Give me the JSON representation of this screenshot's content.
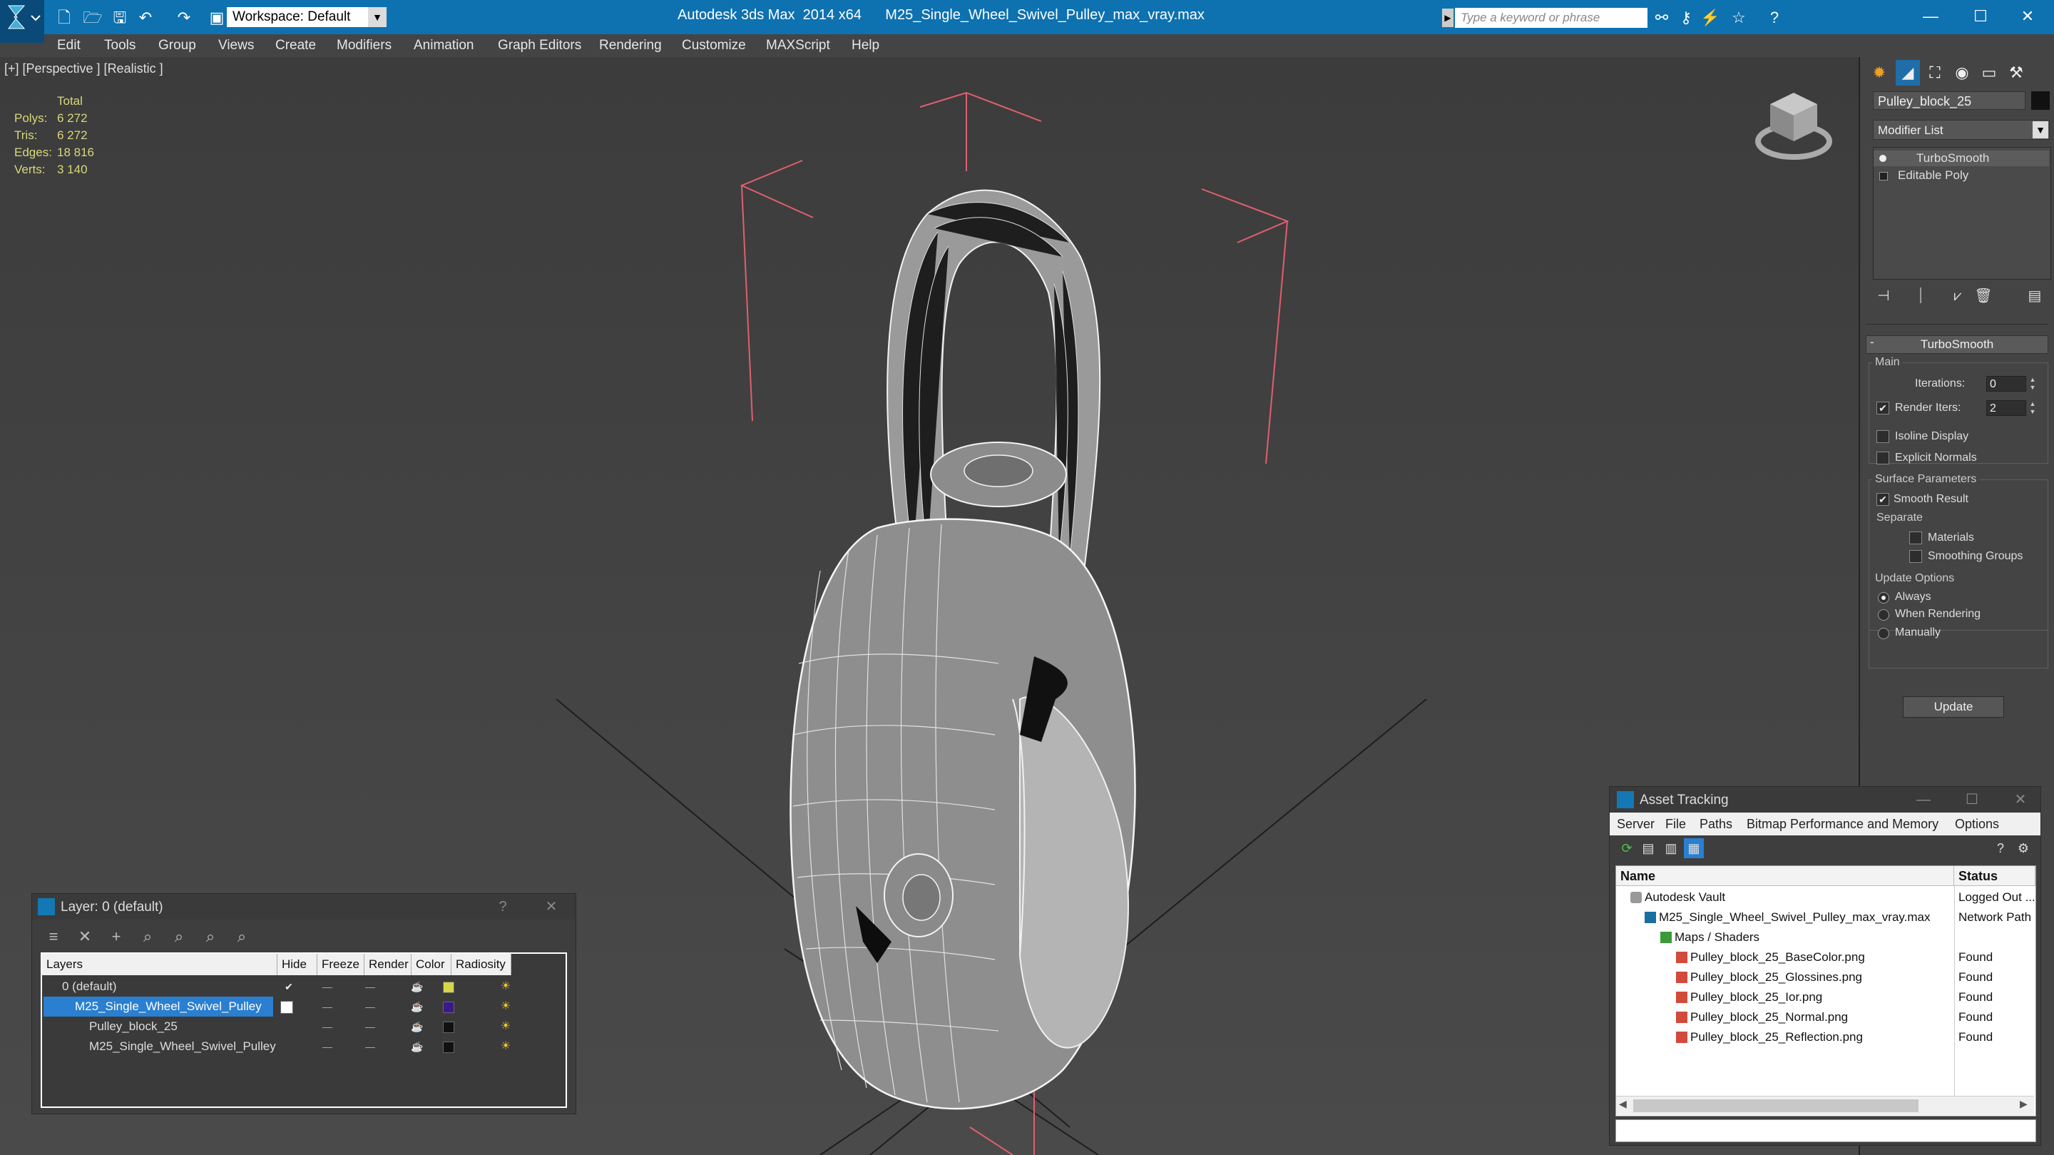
{
  "titlebar": {
    "workspace": "Workspace: Default",
    "app_name": "Autodesk 3ds Max  2014 x64",
    "file_name": "M25_Single_Wheel_Swivel_Pulley_max_vray.max",
    "search_placeholder": "Type a keyword or phrase"
  },
  "menu": [
    "Edit",
    "Tools",
    "Group",
    "Views",
    "Create",
    "Modifiers",
    "Animation",
    "Graph Editors",
    "Rendering",
    "Customize",
    "MAXScript",
    "Help"
  ],
  "viewport": {
    "label": "[+] [Perspective ] [Realistic ]",
    "stats": {
      "header": "Total",
      "rows": [
        {
          "label": "Polys:",
          "value": "6 272"
        },
        {
          "label": "Tris:",
          "value": "6 272"
        },
        {
          "label": "Edges:",
          "value": "18 816"
        },
        {
          "label": "Verts:",
          "value": "3 140"
        }
      ]
    }
  },
  "command_panel": {
    "object_name": "Pulley_block_25",
    "modifier_list": "Modifier List",
    "stack": [
      "TurboSmooth",
      "Editable Poly"
    ],
    "rollout_title": "TurboSmooth",
    "main_group": "Main",
    "iterations_label": "Iterations:",
    "iterations_value": "0",
    "render_iters_label": "Render Iters:",
    "render_iters_value": "2",
    "isoline_label": "Isoline Display",
    "explicit_label": "Explicit Normals",
    "surface_group": "Surface Parameters",
    "smooth_result": "Smooth Result",
    "separate_label": "Separate",
    "materials_label": "Materials",
    "smoothing_groups_label": "Smoothing Groups",
    "update_group": "Update Options",
    "always": "Always",
    "when_rendering": "When Rendering",
    "manually": "Manually",
    "update_button": "Update"
  },
  "layer_dialog": {
    "title": "Layer: 0 (default)",
    "help": "?",
    "close": "✕",
    "columns": [
      "Layers",
      "Hide",
      "Freeze",
      "Render",
      "Color",
      "Radiosity"
    ],
    "rows": [
      {
        "name": "0 (default)",
        "color": "#d6d64a"
      },
      {
        "name": "M25_Single_Wheel_Swivel_Pulley",
        "color": "#3a1a8a"
      },
      {
        "name": "Pulley_block_25",
        "color": "#111111"
      },
      {
        "name": "M25_Single_Wheel_Swivel_Pulley",
        "color": "#111111"
      }
    ]
  },
  "asset_dialog": {
    "title": "Asset Tracking",
    "menu": [
      "Server",
      "File",
      "Paths",
      "Bitmap Performance and Memory",
      "Options"
    ],
    "columns": [
      "Name",
      "Status"
    ],
    "rows": [
      {
        "name": "Autodesk Vault",
        "status": "Logged Out ..."
      },
      {
        "name": "M25_Single_Wheel_Swivel_Pulley_max_vray.max",
        "status": "Network Path"
      },
      {
        "name": "Maps / Shaders",
        "status": ""
      },
      {
        "name": "Pulley_block_25_BaseColor.png",
        "status": "Found"
      },
      {
        "name": "Pulley_block_25_Glossines.png",
        "status": "Found"
      },
      {
        "name": "Pulley_block_25_Ior.png",
        "status": "Found"
      },
      {
        "name": "Pulley_block_25_Normal.png",
        "status": "Found"
      },
      {
        "name": "Pulley_block_25_Reflection.png",
        "status": "Found"
      }
    ]
  }
}
